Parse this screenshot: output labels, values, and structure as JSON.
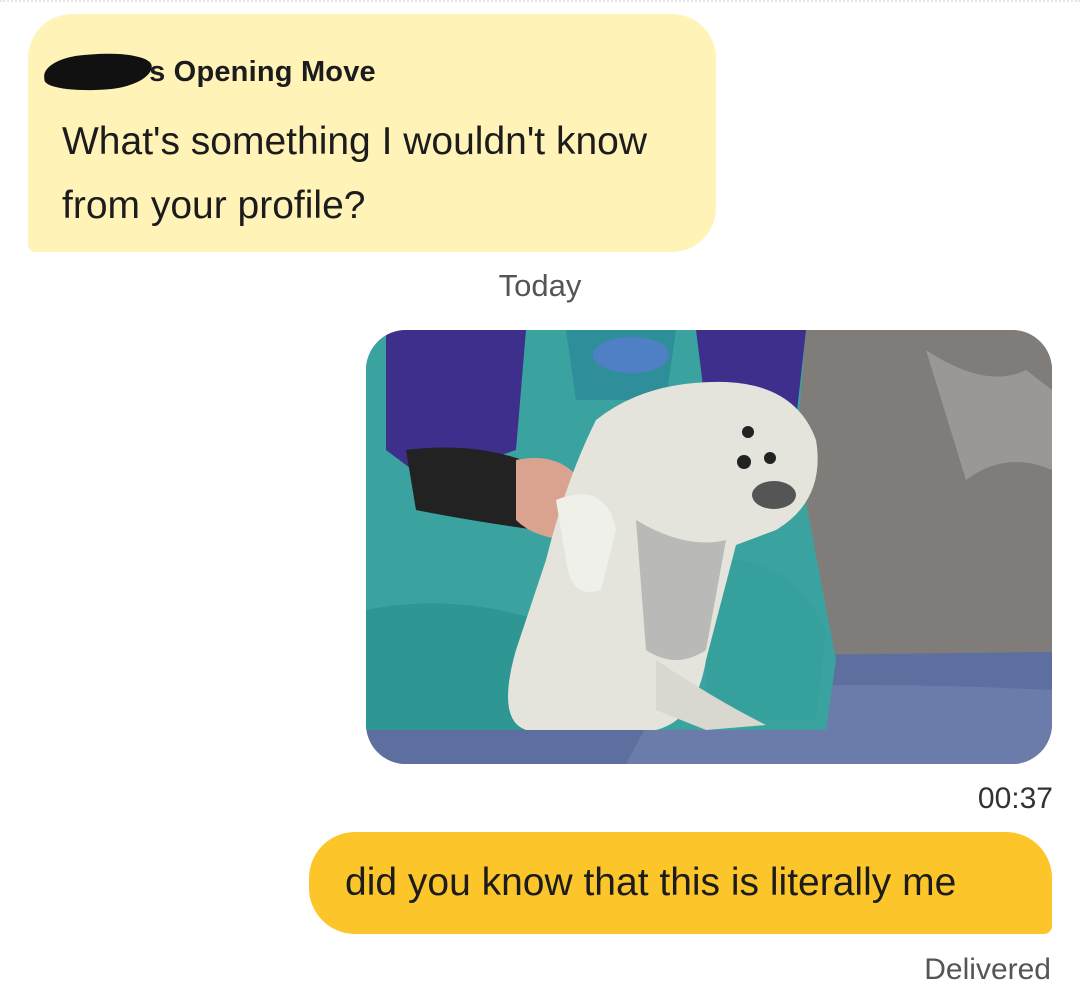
{
  "opening_move": {
    "sender_suffix": "'s Opening Move",
    "prompt": "What's something I wouldn't know from your profile?",
    "background_color": "#fff3b8"
  },
  "separator": {
    "label": "Today"
  },
  "gif_message": {
    "time": "00:37"
  },
  "text_message": {
    "text": "did you know that this is literally me",
    "background_color": "#fcc62b",
    "status": "Delivered"
  }
}
